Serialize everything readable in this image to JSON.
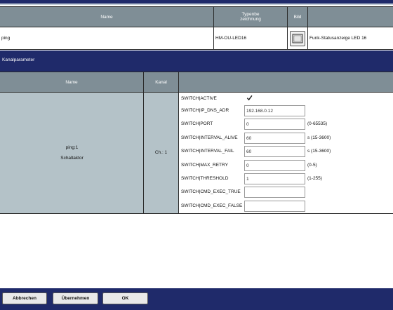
{
  "device_table": {
    "headers": {
      "name": "Name",
      "type_line1": "Typenbe",
      "type_line2": "zeichnung",
      "image": "Bild"
    },
    "row": {
      "name": "ping",
      "type": "HM-OU-LED16",
      "description": "Funk-Statusanzeige LED 16"
    }
  },
  "section_title": "Kanalparameter",
  "channel_table": {
    "headers": {
      "name": "Name",
      "channel": "Kanal"
    },
    "channel_name": "ping:1",
    "channel_type": "Schaltaktor",
    "channel_num": "Ch.: 1",
    "params": [
      {
        "label": "SWITCH|ACTIVE",
        "kind": "checkbox",
        "checked": true
      },
      {
        "label": "SWITCH|IP_DNS_ADR",
        "kind": "input",
        "value": "192.168.0.12",
        "range": ""
      },
      {
        "label": "SWITCH|PORT",
        "kind": "input",
        "value": "0",
        "range": "(0-65535)"
      },
      {
        "label": "SWITCH|INTERVAL_ALIVE",
        "kind": "input",
        "value": "60",
        "range": "s (15-3600)"
      },
      {
        "label": "SWITCH|INTERVAL_FAIL",
        "kind": "input",
        "value": "60",
        "range": "s (15-3600)"
      },
      {
        "label": "SWITCH|MAX_RETRY",
        "kind": "input",
        "value": "0",
        "range": "(0-5)"
      },
      {
        "label": "SWITCH|THRESHOLD",
        "kind": "input",
        "value": "1",
        "range": "(1-255)"
      },
      {
        "label": "SWITCH|CMD_EXEC_TRUE",
        "kind": "input",
        "value": "",
        "range": ""
      },
      {
        "label": "SWITCH|CMD_EXEC_FALSE",
        "kind": "input",
        "value": "",
        "range": ""
      }
    ]
  },
  "footer": {
    "cancel": "Abbrechen",
    "apply": "Übernehmen",
    "ok": "OK"
  }
}
